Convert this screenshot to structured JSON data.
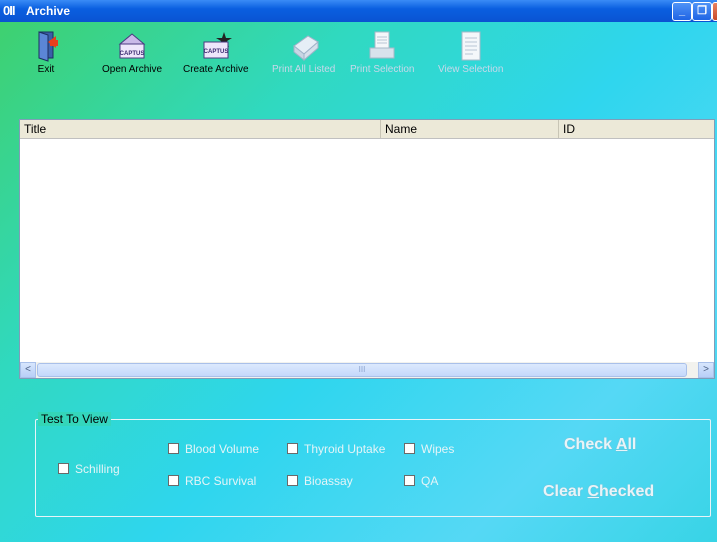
{
  "window": {
    "title": "Archive",
    "app_icon": "0II",
    "controls": {
      "minimize_icon": "_",
      "restore_icon": "❐",
      "close_icon": "x"
    }
  },
  "toolbar": {
    "items": [
      {
        "label": "Exit",
        "icon": "exit-door-icon",
        "enabled": true
      },
      {
        "label": "Open Archive",
        "icon": "captus-open-icon",
        "enabled": true
      },
      {
        "label": "Create Archive",
        "icon": "captus-create-icon",
        "enabled": true
      },
      {
        "label": "Print All Listed",
        "icon": "printer-icon",
        "enabled": false
      },
      {
        "label": "Print Selection",
        "icon": "print-document-icon",
        "enabled": false
      },
      {
        "label": "View Selection",
        "icon": "view-document-icon",
        "enabled": false
      }
    ],
    "captus_text": "CAPTUS"
  },
  "list": {
    "columns": [
      "Title",
      "Name",
      "ID"
    ],
    "rows": [],
    "scroll_left": "<",
    "scroll_right": ">",
    "thumb_grip": "III"
  },
  "filter": {
    "legend": "Test To View",
    "checkboxes": [
      {
        "label": "Schilling",
        "checked": false
      },
      {
        "label": "Blood Volume",
        "checked": false
      },
      {
        "label": "RBC Survival",
        "checked": false
      },
      {
        "label": "Thyroid Uptake",
        "checked": false
      },
      {
        "label": "Bioassay",
        "checked": false
      },
      {
        "label": "Wipes",
        "checked": false
      },
      {
        "label": "QA",
        "checked": false
      }
    ],
    "check_all": {
      "pre": "Check ",
      "accel": "A",
      "post": "ll"
    },
    "clear_checked": {
      "pre": "Clear ",
      "accel": "C",
      "post": "hecked"
    }
  }
}
